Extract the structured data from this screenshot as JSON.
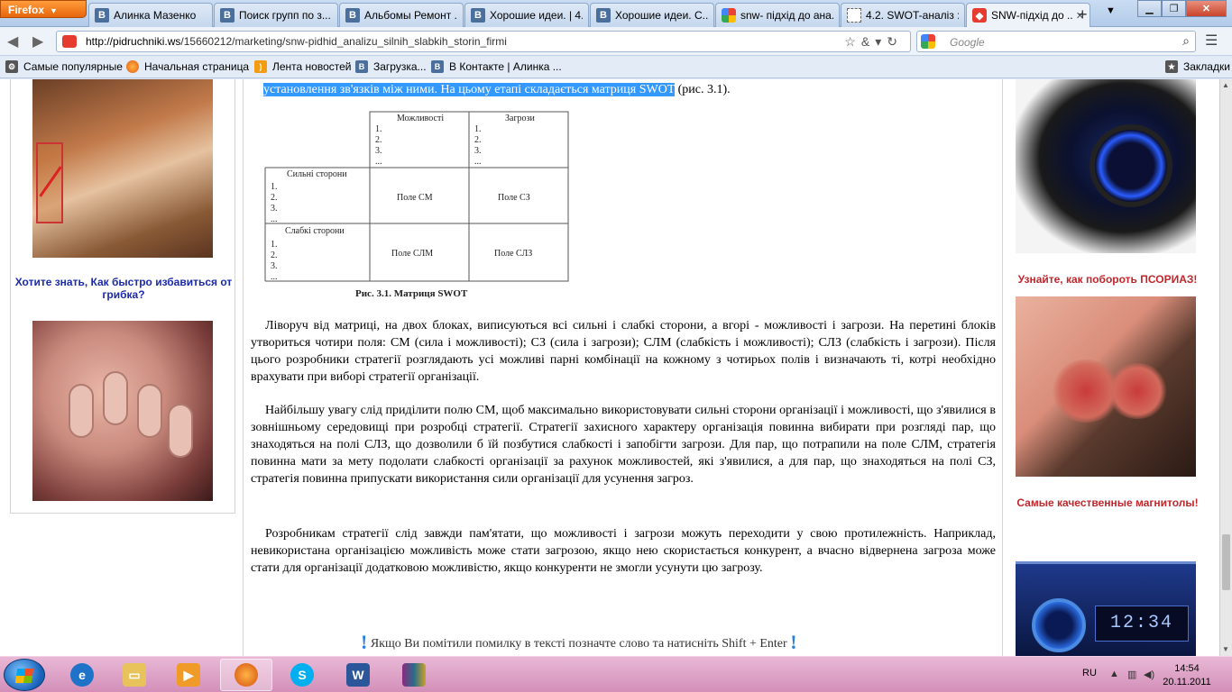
{
  "browser": {
    "menu_label": "Firefox",
    "tabs": [
      {
        "title": "Алинка Мазенко",
        "icon": "vk-icon"
      },
      {
        "title": "Поиск групп по з...",
        "icon": "vk-icon"
      },
      {
        "title": "Альбомы Ремонт ...",
        "icon": "vk-icon"
      },
      {
        "title": "Хорошие идеи. | 4...",
        "icon": "vk-icon"
      },
      {
        "title": "Хорошие идеи. С...",
        "icon": "vk-icon"
      },
      {
        "title": "snw- підхід до ана...",
        "icon": "google-icon"
      },
      {
        "title": "4.2. SWOT-аналіз :...",
        "icon": "blank-page-icon"
      },
      {
        "title": "SNW-підхід до ...",
        "icon": "site-icon",
        "active": true
      }
    ],
    "url_host": "http://pidruchniki.ws",
    "url_path": "/15660212/marketing/snw-pidhid_analizu_silnih_slabkih_storin_firmi",
    "search_placeholder": "Google",
    "bookmarks_label": "Закладки",
    "bookmarks": [
      {
        "label": "Самые популярные",
        "icon": "gear-icon"
      },
      {
        "label": "Начальная страница",
        "icon": "firefox-icon"
      },
      {
        "label": "Лента новостей",
        "icon": "rss-icon"
      },
      {
        "label": "Загрузка...",
        "icon": "vk-icon"
      },
      {
        "label": "В Контакте | Алинка ...",
        "icon": "vk-icon"
      }
    ]
  },
  "left_ads": {
    "ad1_text": "Хотите знать, Как быстро избавиться от грибка?"
  },
  "right_ads": {
    "ad1_text": "Узнайте, как побороть ПСОРИАЗ!",
    "ad2_text": "Самые качественные магнитолы!",
    "radio_display": "12:34"
  },
  "article": {
    "highlight_selected": "установлення зв'язків між ними. На цьому етапі складається матриця SWOT",
    "highlight_rest": " (рис. 3.1).",
    "matrix": {
      "col_opportunities": "Можливості",
      "col_threats": "Загрози",
      "row_strengths": "Сильні сторони",
      "row_weaknesses": "Слабкі сторони",
      "list": [
        "1.",
        "2.",
        "3.",
        "..."
      ],
      "cell_sm": "Поле СМ",
      "cell_sz": "Поле СЗ",
      "cell_slm": "Поле СЛМ",
      "cell_slz": "Поле СЛЗ",
      "caption": "Рис. 3.1. Матриця SWOT"
    },
    "p1": "Ліворуч від матриці, на двох блоках, виписуються всі сильні і слабкі сторони, а вгорі - можливості і загрози. На перетині блоків утвориться чотири поля: СМ (сила і можливості); СЗ (сила і загрози); СЛМ (слабкість і можливості); СЛЗ (слабкість і загрози). Після цього розробники стратегії розглядають усі можливі парні комбінації на кожному з чотирьох полів і визначають ті, котрі необхідно врахувати при виборі стратегії організації.",
    "p2": "Найбільшу увагу слід приділити полю СМ, щоб максимально використовувати сильні сторони організації і можливості, що з'явилися в зовнішньому середовищі при розробці стратегії. Стратегії захисного характеру організація повинна вибирати при розгляді пар, що знаходяться на полі СЛЗ, що дозволили б їй позбутися слабкості і запобігти загрози. Для пар, що потрапили на поле СЛМ, стратегія повинна мати за мету подолати слабкості організації за рахунок можливостей, які з'явилися, а для пар, що знаходяться на полі СЗ, стратегія повинна припускати використання сили організації для усунення загроз.",
    "p3": "Розробникам стратегії слід завжди пам'ятати, що можливості і загрози можуть переходити у свою протилежність. Наприклад, невикористана організацією можливість може стати загрозою, якщо нею скористається конкурент, а вчасно відвернена загроза може стати для організації додатковою можливістю, якщо конкуренти не змогли усунути цю загрозу.",
    "notice": "Якщо Ви помітили помилку в тексті позначте слово та натисніть Shift + Enter",
    "notice_mark": "!"
  },
  "taskbar": {
    "lang": "RU",
    "time": "14:54",
    "date": "20.11.2011",
    "apps": [
      "internet-explorer-icon",
      "explorer-icon",
      "media-player-icon",
      "firefox-icon",
      "skype-icon",
      "word-icon",
      "winrar-icon"
    ]
  }
}
